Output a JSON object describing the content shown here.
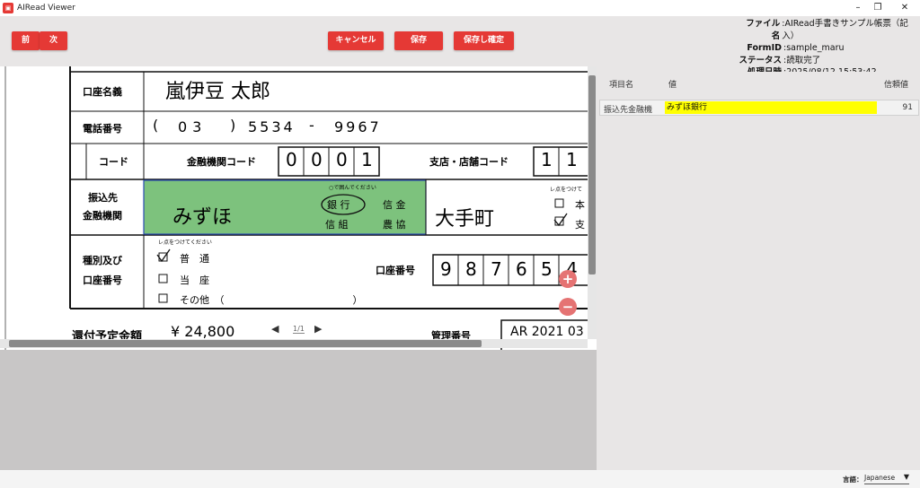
{
  "titlebar": {
    "title": "AIRead Viewer",
    "minimize": "–",
    "restore": "❐",
    "close": "✕"
  },
  "toolbar": {
    "prev": "前",
    "next": "次",
    "cancel": "キャンセル",
    "save": "保存",
    "save_confirm": "保存し確定"
  },
  "info": {
    "file_label": "ファイル名",
    "file_value": ":AIRead手書きサンプル帳票（記入）",
    "formid_label": "FormID",
    "formid_value": ":sample_maru",
    "status_label": "ステータス",
    "status_value": ":読取完了",
    "datetime_label": "処理日時",
    "datetime_value": ":2025/08/12 15:53:42"
  },
  "document": {
    "account_name_label": "口座名義",
    "account_name_value": "嵐伊豆 太郎",
    "phone_label": "電話番号",
    "phone_paren_open": "(",
    "phone_area": "03",
    "phone_paren_close": ")",
    "phone_mid": "5534",
    "phone_dash": "-",
    "phone_last": "9967",
    "code_label": "コード",
    "bank_code_label": "金融機関コード",
    "bank_code_digits": [
      "0",
      "0",
      "0",
      "1"
    ],
    "branch_code_label": "支店・店舗コード",
    "branch_code_digits": [
      "1",
      "1"
    ],
    "transfer_label_1": "振込先",
    "transfer_label_2": "金融機関",
    "circle_note": "○で囲んでください",
    "bank_name_value": "みずほ",
    "bank_type_1": "銀 行",
    "bank_type_2": "信 金",
    "bank_type_3": "信 組",
    "bank_type_4": "農 協",
    "branch_value": "大手町",
    "check_note_1": "レ点をつけて",
    "branch_type_1": "本",
    "branch_type_2": "支",
    "type_label_1": "種別及び",
    "type_label_2": "口座番号",
    "check_note_2": "レ点をつけてください",
    "acct_type_1": "普　通",
    "acct_type_2": "当　座",
    "acct_type_3": "その他　（　　　　　　　　　　　　　）",
    "acct_number_label": "口座番号",
    "acct_number_digits": [
      "9",
      "8",
      "7",
      "6",
      "5",
      "4"
    ],
    "refund_label": "還付予定金額",
    "refund_value": "¥ 24,800",
    "mgmt_label": "管理番号",
    "mgmt_value": "AR 2021 03"
  },
  "pager": {
    "text": "1/1",
    "prev": "◀",
    "next": "▶"
  },
  "zoom": {
    "in": "+",
    "out": "−"
  },
  "panel": {
    "headers": {
      "item": "項目名",
      "value": "値",
      "confidence": "信頼値"
    },
    "rows": [
      {
        "name": "振込先金融機",
        "value": "みずほ銀行",
        "confidence": "91"
      }
    ]
  },
  "footer": {
    "lang_label": "言語：",
    "lang_value": "Japanese",
    "lang_caret": "▼"
  },
  "colors": {
    "accent": "#e53935",
    "highlight": "#ffff00",
    "field_box": "#7dc27d"
  }
}
